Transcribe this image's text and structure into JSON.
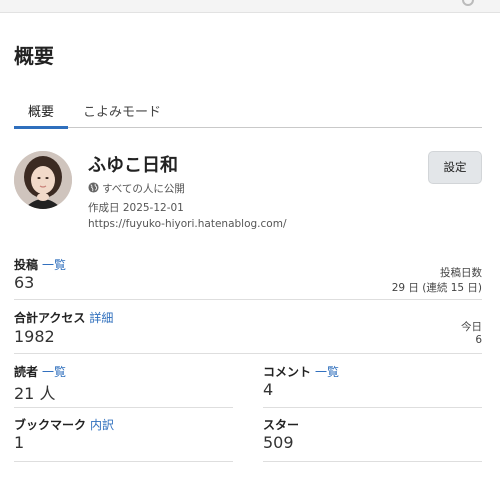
{
  "page": {
    "title": "概要"
  },
  "tabs": [
    {
      "label": "概要",
      "active": true
    },
    {
      "label": "こよみモード",
      "active": false
    }
  ],
  "profile": {
    "name": "ふゆこ日和",
    "visibility_icon": "globe-icon",
    "visibility": "すべての人に公開",
    "created": "作成日 2025-12-01",
    "url": "https://fuyuko-hiyori.hatenablog.com/"
  },
  "settings_button": "設定",
  "stats": {
    "posts": {
      "label": "投稿",
      "link": "一覧",
      "value": "63",
      "days_label": "投稿日数",
      "days_value": "29 日 (連続 15 日)"
    },
    "access": {
      "label": "合計アクセス",
      "link": "詳細",
      "value": "1982",
      "today_label": "今日",
      "today_value": "6"
    },
    "readers": {
      "label": "読者",
      "link": "一覧",
      "value": "21 人"
    },
    "comments": {
      "label": "コメント",
      "link": "一覧",
      "value": "4"
    },
    "bookmarks": {
      "label": "ブックマーク",
      "link": "内訳",
      "value": "1"
    },
    "stars": {
      "label": "スター",
      "value": "509"
    }
  },
  "colors": {
    "accent": "#2f6fbd",
    "button_bg": "#e3e6e9",
    "divider": "#dedede"
  }
}
